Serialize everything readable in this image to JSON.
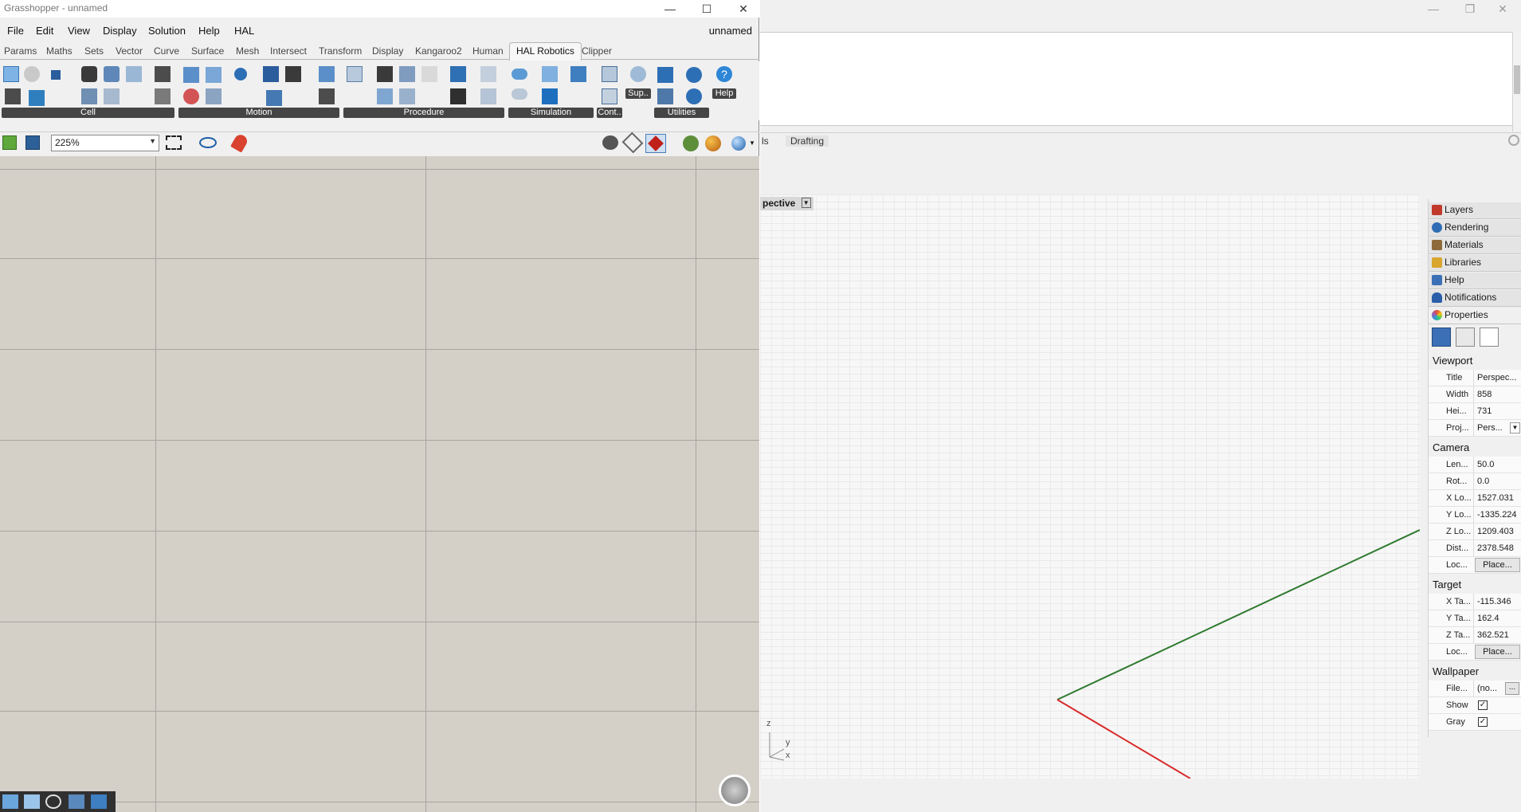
{
  "grasshopper": {
    "title": "Grasshopper - unnamed",
    "document_name": "unnamed",
    "menu": [
      "File",
      "Edit",
      "View",
      "Display",
      "Solution",
      "Help",
      "HAL"
    ],
    "tabs": [
      "Params",
      "Maths",
      "Sets",
      "Vector",
      "Curve",
      "Surface",
      "Mesh",
      "Intersect",
      "Transform",
      "Display",
      "Kangaroo2",
      "Human",
      "HAL Robotics",
      "Clipper"
    ],
    "active_tab": "HAL Robotics",
    "ribbon_groups": [
      "Cell",
      "Motion",
      "Procedure",
      "Simulation",
      "Cont..",
      "Utilities"
    ],
    "ribbon_buttons": {
      "sup": "Sup..",
      "help": "Help"
    },
    "zoom": "225%"
  },
  "rhino": {
    "view_tabs": {
      "partial": "ls",
      "drafting": "Drafting"
    },
    "viewport_label": "pective",
    "axis": {
      "z": "z",
      "y": "y",
      "x": "x"
    },
    "panel_tabs": [
      {
        "label": "Layers",
        "color": "#c0392b"
      },
      {
        "label": "Rendering",
        "color": "#2e6db4"
      },
      {
        "label": "Materials",
        "color": "#8e6a3a"
      },
      {
        "label": "Libraries",
        "color": "#d9a62e"
      },
      {
        "label": "Help",
        "color": "#3b6fb6"
      },
      {
        "label": "Notifications",
        "color": "#2a5ea8"
      },
      {
        "label": "Properties",
        "color": "#7a3fb0"
      }
    ],
    "properties": {
      "viewport": {
        "heading": "Viewport",
        "title_k": "Title",
        "title_v": "Perspec...",
        "width_k": "Width",
        "width_v": "858",
        "height_k": "Hei...",
        "height_v": "731",
        "proj_k": "Proj...",
        "proj_v": "Pers..."
      },
      "camera": {
        "heading": "Camera",
        "len_k": "Len...",
        "len_v": "50.0",
        "rot_k": "Rot...",
        "rot_v": "0.0",
        "xl_k": "X Lo...",
        "xl_v": "1527.031",
        "yl_k": "Y Lo...",
        "yl_v": "-1335.224",
        "zl_k": "Z Lo...",
        "zl_v": "1209.403",
        "dist_k": "Dist...",
        "dist_v": "2378.548",
        "loc_k": "Loc...",
        "loc_btn": "Place..."
      },
      "target": {
        "heading": "Target",
        "xt_k": "X Ta...",
        "xt_v": "-115.346",
        "yt_k": "Y Ta...",
        "yt_v": "162.4",
        "zt_k": "Z Ta...",
        "zt_v": "362.521",
        "loc_k": "Loc...",
        "loc_btn": "Place..."
      },
      "wallpaper": {
        "heading": "Wallpaper",
        "file_k": "File...",
        "file_v": "(no...",
        "file_btn": "...",
        "show_k": "Show",
        "gray_k": "Gray",
        "check": "✓"
      }
    }
  }
}
